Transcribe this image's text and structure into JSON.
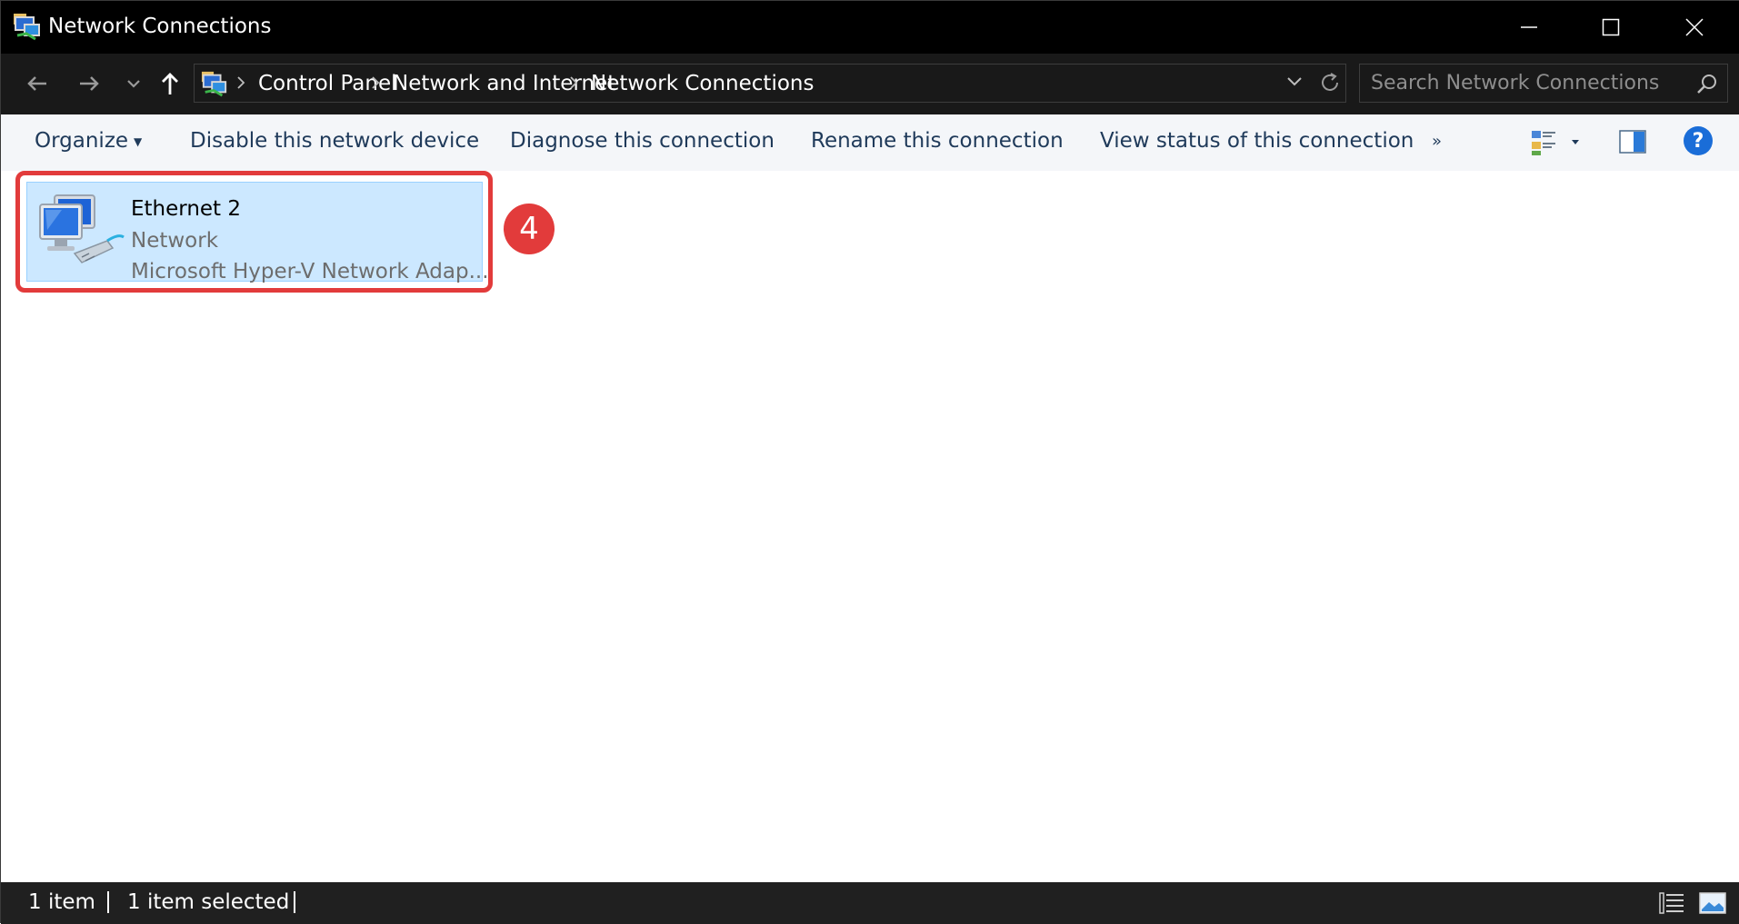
{
  "window": {
    "title": "Network Connections"
  },
  "address": {
    "crumbs": [
      "Control Panel",
      "Network and Internet",
      "Network Connections"
    ]
  },
  "search": {
    "placeholder": "Search Network Connections"
  },
  "commands": {
    "organize": "Organize",
    "disable": "Disable this network device",
    "diagnose": "Diagnose this connection",
    "rename": "Rename this connection",
    "view_status": "View status of this connection",
    "more": "»"
  },
  "connection": {
    "name": "Ethernet 2",
    "network": "Network",
    "adapter": "Microsoft Hyper-V Network Adap..."
  },
  "annotation": {
    "step": "4",
    "color": "#e23b3b"
  },
  "status": {
    "count": "1 item",
    "selected": "1 item selected"
  },
  "icons": [
    "network-connections-icon",
    "minimize-icon",
    "maximize-icon",
    "close-icon",
    "back-arrow-icon",
    "forward-arrow-icon",
    "recent-locations-chevron-icon",
    "up-arrow-icon",
    "chevron-right-icon",
    "chevron-down-icon",
    "refresh-icon",
    "search-icon",
    "change-view-icon",
    "preview-pane-icon",
    "help-icon",
    "network-adapter-icon",
    "details-view-icon",
    "large-icons-view-icon"
  ]
}
